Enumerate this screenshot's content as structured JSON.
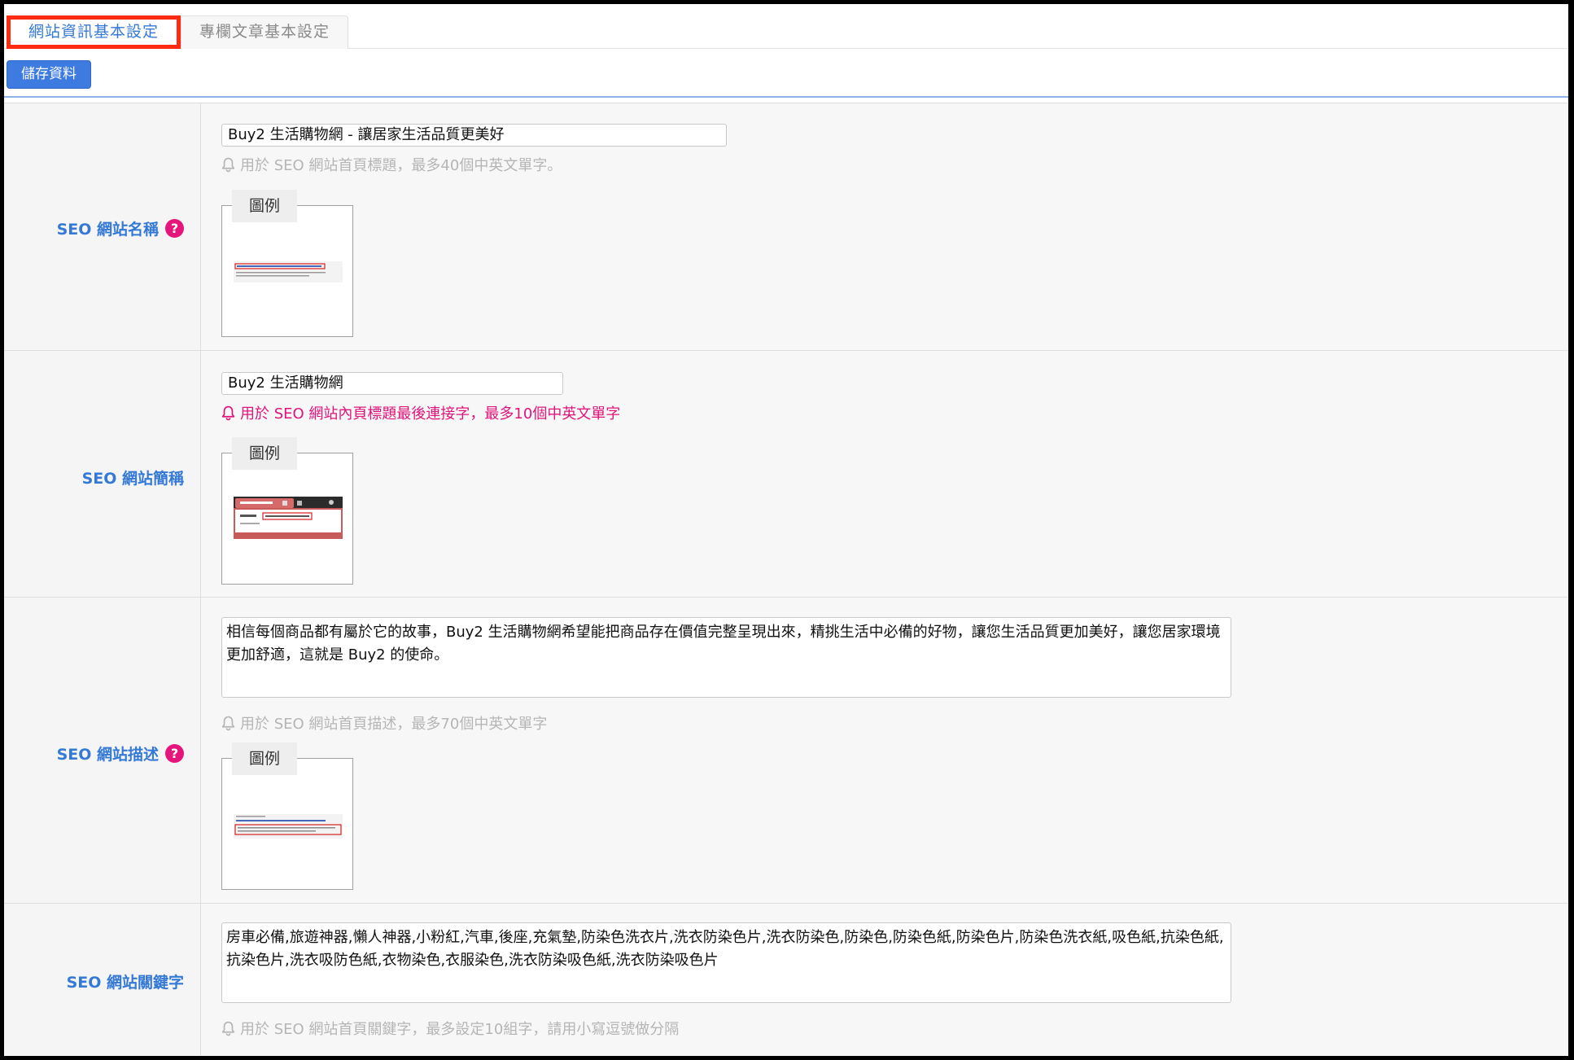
{
  "tabs": [
    {
      "label": "網站資訊基本設定",
      "active": true
    },
    {
      "label": "專欄文章基本設定",
      "active": false
    }
  ],
  "toolbar": {
    "save_label": "儲存資料"
  },
  "icons": {
    "help": "question-circle-icon",
    "hint": "bell-icon"
  },
  "help_glyph": "?",
  "legend_label": "圖例",
  "colors": {
    "label": "#3579d6",
    "alert": "#e0137a",
    "help": "#e5157b",
    "hint": "#b5b5b5",
    "save_button": "#3d7be0",
    "active_tab_outline": "#ff2a12"
  },
  "fields": {
    "name": {
      "label": "SEO 網站名稱",
      "value": "Buy2 生活購物網 - 讓居家生活品質更美好",
      "hint": "用於 SEO 網站首頁標題，最多40個中英文單字。"
    },
    "short_name": {
      "label": "SEO 網站簡稱",
      "value": "Buy2 生活購物網",
      "hint": "用於 SEO 網站內頁標題最後連接字，最多10個中英文單字"
    },
    "description": {
      "label": "SEO 網站描述",
      "value": "相信每個商品都有屬於它的故事，Buy2 生活購物網希望能把商品存在價值完整呈現出來，精挑生活中必備的好物，讓您生活品質更加美好，讓您居家環境更加舒適，這就是 Buy2 的使命。",
      "hint": "用於 SEO 網站首頁描述，最多70個中英文單字"
    },
    "keywords": {
      "label": "SEO 網站關鍵字",
      "value": "房車必備,旅遊神器,懶人神器,小粉紅,汽車,後座,充氣墊,防染色洗衣片,洗衣防染色片,洗衣防染色,防染色,防染色紙,防染色片,防染色洗衣紙,吸色紙,抗染色紙,抗染色片,洗衣吸防色紙,衣物染色,衣服染色,洗衣防染吸色紙,洗衣防染吸色片",
      "hint": "用於 SEO 網站首頁關鍵字，最多設定10組字，請用小寫逗號做分隔"
    }
  }
}
